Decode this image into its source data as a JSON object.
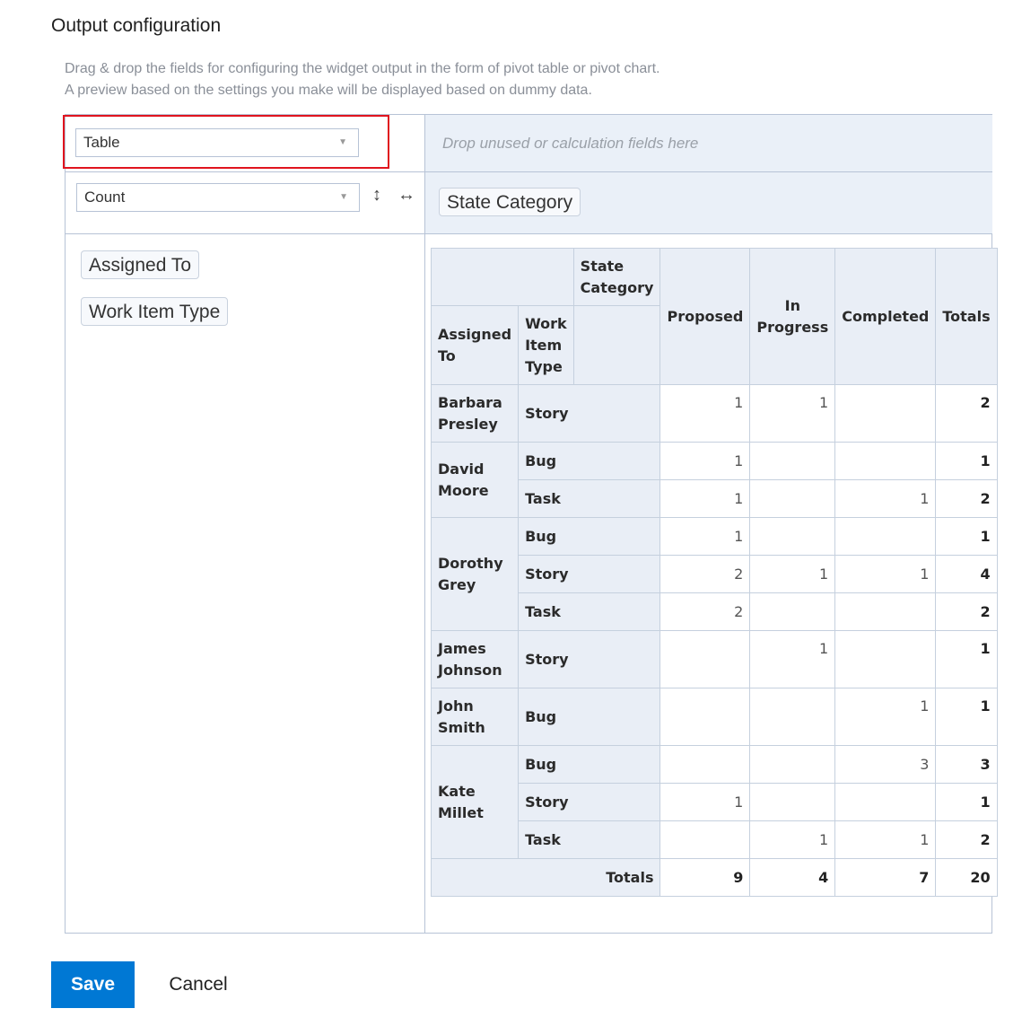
{
  "title": "Output configuration",
  "description": [
    "Drag & drop the fields for configuring the widget output in the form of pivot table or pivot chart.",
    "A preview based on the settings you make will be displayed based on dummy data."
  ],
  "output_type": {
    "selected": "Table"
  },
  "aggregation": {
    "selected": "Count"
  },
  "drop_hint": "Drop unused or calculation fields here",
  "column_fields": [
    "State Category"
  ],
  "row_fields": [
    "Assigned To",
    "Work Item Type"
  ],
  "pivot": {
    "corner_col_label": "State Category",
    "row_headers": [
      "Assigned To",
      "Work Item Type"
    ],
    "columns": [
      "Proposed",
      "In Progress",
      "Completed",
      "Totals"
    ],
    "groups": [
      {
        "name": "Barbara Presley",
        "rows": [
          {
            "type": "Story",
            "values": [
              "1",
              "1",
              "",
              "2"
            ]
          }
        ]
      },
      {
        "name": "David Moore",
        "rows": [
          {
            "type": "Bug",
            "values": [
              "1",
              "",
              "",
              "1"
            ]
          },
          {
            "type": "Task",
            "values": [
              "1",
              "",
              "1",
              "2"
            ]
          }
        ]
      },
      {
        "name": "Dorothy Grey",
        "rows": [
          {
            "type": "Bug",
            "values": [
              "1",
              "",
              "",
              "1"
            ]
          },
          {
            "type": "Story",
            "values": [
              "2",
              "1",
              "1",
              "4"
            ]
          },
          {
            "type": "Task",
            "values": [
              "2",
              "",
              "",
              "2"
            ]
          }
        ]
      },
      {
        "name": "James Johnson",
        "rows": [
          {
            "type": "Story",
            "values": [
              "",
              "1",
              "",
              "1"
            ]
          }
        ]
      },
      {
        "name": "John Smith",
        "rows": [
          {
            "type": "Bug",
            "values": [
              "",
              "",
              "1",
              "1"
            ]
          }
        ]
      },
      {
        "name": "Kate Millet",
        "rows": [
          {
            "type": "Bug",
            "values": [
              "",
              "",
              "3",
              "3"
            ]
          },
          {
            "type": "Story",
            "values": [
              "1",
              "",
              "",
              "1"
            ]
          },
          {
            "type": "Task",
            "values": [
              "",
              "1",
              "1",
              "2"
            ]
          }
        ]
      }
    ],
    "totals_label": "Totals",
    "totals": [
      "9",
      "4",
      "7",
      "20"
    ]
  },
  "buttons": {
    "save": "Save",
    "cancel": "Cancel"
  },
  "icons": {
    "dropdown": "chevron-down-icon",
    "swap_vertical": "swap-vertical-icon",
    "swap_horizontal": "swap-horizontal-icon"
  },
  "colors": {
    "accent": "#0078d4",
    "highlight": "#e0141e",
    "header_bg": "#e9eef6"
  }
}
